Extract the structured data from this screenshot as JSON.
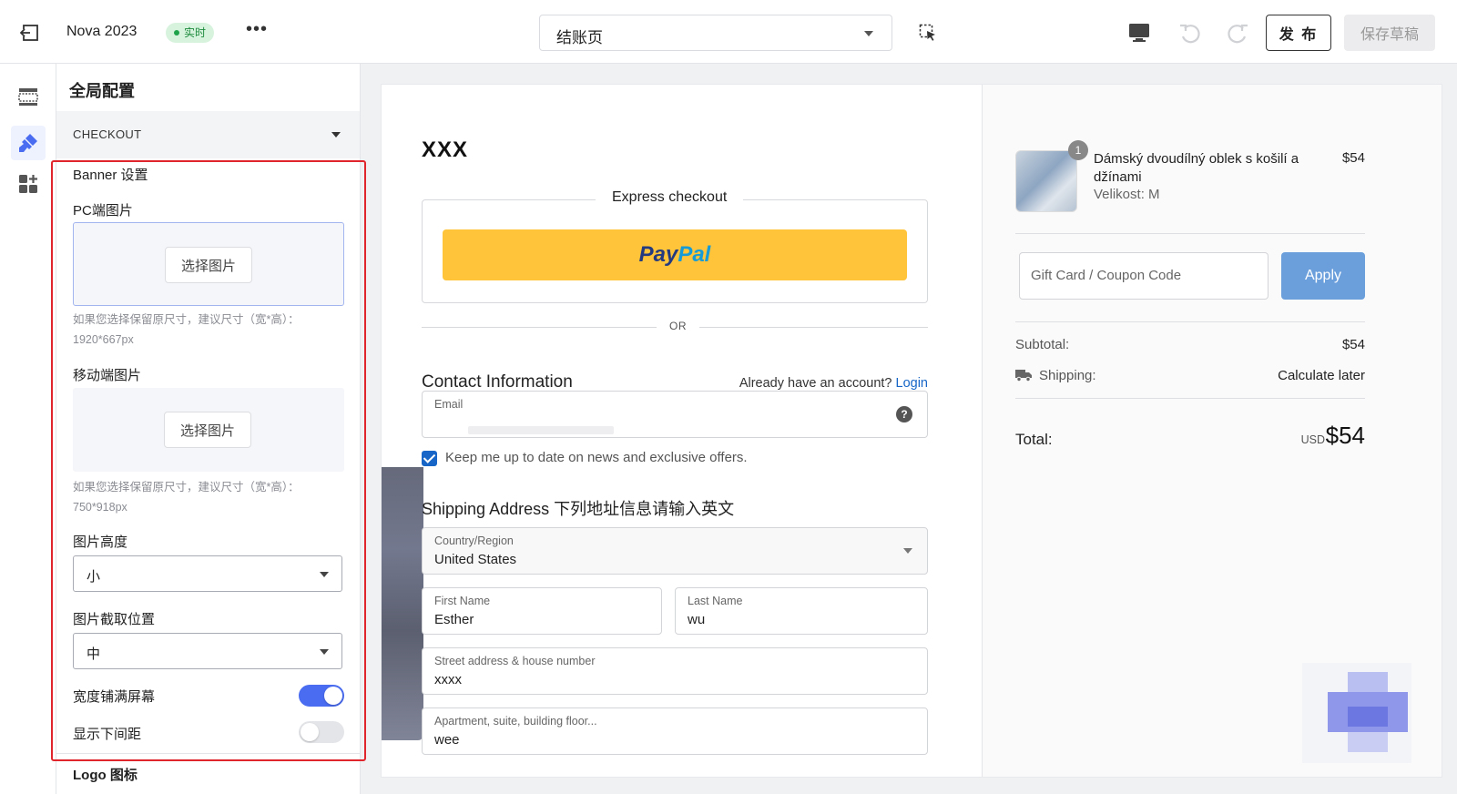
{
  "topbar": {
    "title": "Nova 2023",
    "badge": "实时",
    "more": "•••",
    "page_select": "结账页",
    "publish": "发 布",
    "save_draft": "保存草稿"
  },
  "panel": {
    "title": "全局配置",
    "section": "CHECKOUT",
    "banner_title": "Banner 设置",
    "pc_label": "PC端图片",
    "pick_image": "选择图片",
    "pc_hint": "如果您选择保留原尺寸，建议尺寸（宽*高）：1920*667px",
    "mobile_label": "移动端图片",
    "mobile_hint": "如果您选择保留原尺寸，建议尺寸（宽*高）：750*918px",
    "height_label": "图片高度",
    "height_value": "小",
    "crop_label": "图片截取位置",
    "crop_value": "中",
    "fullwidth_label": "宽度铺满屏幕",
    "fullwidth_on": true,
    "bottom_gap_label": "显示下间距",
    "bottom_gap_on": false,
    "logo_label": "Logo 图标"
  },
  "preview": {
    "store_name": "XXX",
    "express_checkout": "Express checkout",
    "paypal_a": "Pay",
    "paypal_b": "Pal",
    "or": "OR",
    "contact_heading": "Contact Information",
    "have_account": "Already have an account?",
    "login": "Login",
    "email_label": "Email",
    "help": "?",
    "newsletter": "Keep me up to date on news and exclusive offers.",
    "newsletter_checked": true,
    "shipping_heading": "Shipping Address 下列地址信息请输入英文",
    "country_label": "Country/Region",
    "country_value": "United States",
    "first_name_label": "First Name",
    "first_name_value": "Esther",
    "last_name_label": "Last Name",
    "last_name_value": "wu",
    "street_label": "Street address & house number",
    "street_value": "xxxx",
    "apt_label": "Apartment, suite, building floor...",
    "apt_value": "wee"
  },
  "summary": {
    "qty": "1",
    "product_name": "Dámský dvoudílný oblek s košilí a džínami",
    "variant": "Velikost: M",
    "price": "$54",
    "coupon_placeholder": "Gift Card / Coupon Code",
    "apply": "Apply",
    "subtotal_label": "Subtotal:",
    "subtotal_value": "$54",
    "shipping_label": "Shipping:",
    "shipping_value": "Calculate later",
    "total_label": "Total:",
    "currency": "USD",
    "total_value": "$54"
  },
  "colors": {
    "accent": "#4a6cf0",
    "highlight": "#e0262c",
    "paypal_yellow": "#ffc439",
    "apply_blue": "#6a9fdc",
    "link_blue": "#1766c7"
  },
  "icons": [
    "exit-icon",
    "select-tool-icon",
    "desktop-icon",
    "undo-icon",
    "redo-icon",
    "layout-icon",
    "brush-icon",
    "apps-icon",
    "truck-icon"
  ]
}
